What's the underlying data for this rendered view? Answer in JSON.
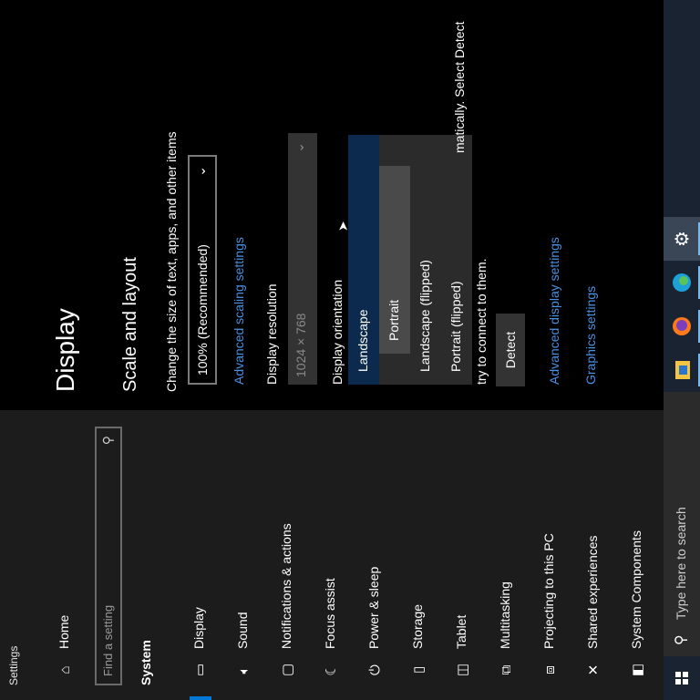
{
  "window": {
    "title": "Settings"
  },
  "sidebar": {
    "home": "Home",
    "search_placeholder": "Find a setting",
    "section": "System",
    "items": [
      {
        "label": "Display",
        "icon": "monitor-icon",
        "active": true
      },
      {
        "label": "Sound",
        "icon": "speaker-icon"
      },
      {
        "label": "Notifications & actions",
        "icon": "notification-icon"
      },
      {
        "label": "Focus assist",
        "icon": "moon-icon"
      },
      {
        "label": "Power & sleep",
        "icon": "power-icon"
      },
      {
        "label": "Storage",
        "icon": "storage-icon"
      },
      {
        "label": "Tablet",
        "icon": "tablet-icon"
      },
      {
        "label": "Multitasking",
        "icon": "multitasking-icon"
      },
      {
        "label": "Projecting to this PC",
        "icon": "projector-icon"
      },
      {
        "label": "Shared experiences",
        "icon": "shared-icon"
      },
      {
        "label": "System Components",
        "icon": "components-icon"
      }
    ]
  },
  "main": {
    "title": "Display",
    "scale_heading": "Scale and layout",
    "scale_description": "Change the size of text, apps, and other items",
    "scale_value": "100% (Recommended)",
    "advanced_scaling_link": "Advanced scaling settings",
    "resolution_label": "Display resolution",
    "resolution_value": "1024 × 768",
    "orientation_label": "Display orientation",
    "orientation_options": [
      "Landscape",
      "Portrait",
      "Landscape (flipped)",
      "Portrait (flipped)"
    ],
    "detect_text_1": "matically. Select Detect",
    "detect_text_2": "try to connect to them.",
    "detect_button": "Detect",
    "advanced_display_link": "Advanced display settings",
    "graphics_link": "Graphics settings"
  },
  "taskbar": {
    "search_placeholder": "Type here to search",
    "apps": [
      "file-explorer-icon",
      "firefox-icon",
      "edge-icon",
      "settings-gear-icon"
    ]
  },
  "colors": {
    "accent": "#0078d7",
    "link": "#4a90e2",
    "taskbar": "#1a2331"
  }
}
